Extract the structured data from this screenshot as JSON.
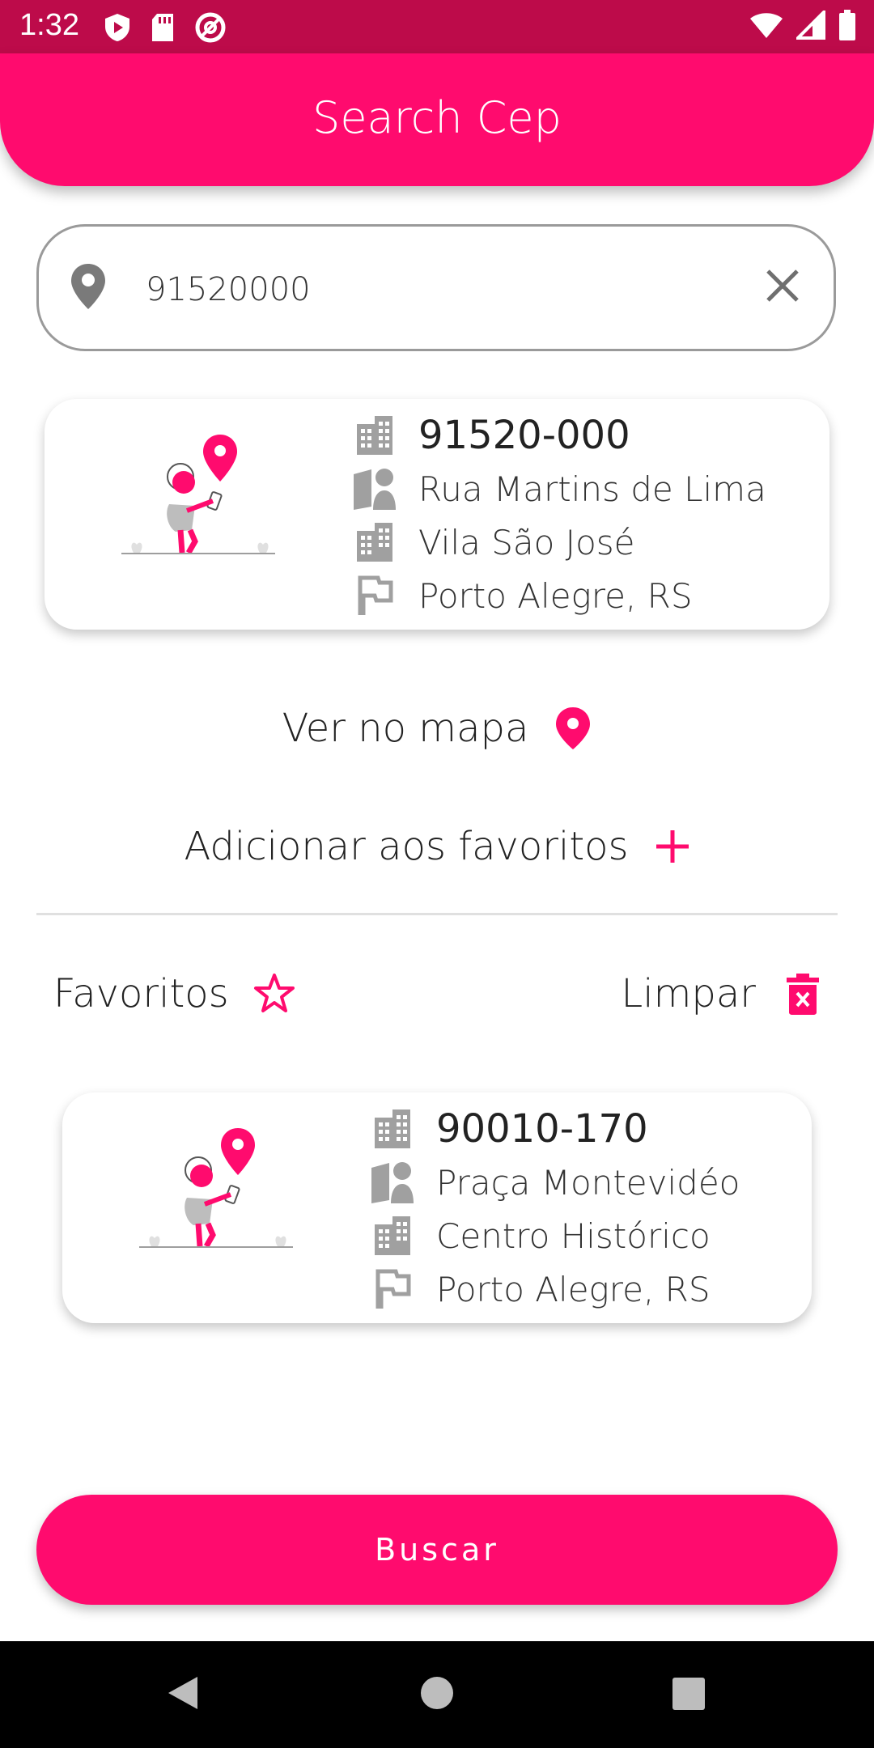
{
  "status_bar": {
    "time": "1:32"
  },
  "app_bar": {
    "title": "Search Cep"
  },
  "search": {
    "value": "91520000",
    "placeholder": ""
  },
  "result_card": {
    "cep": "91520-000",
    "street": "Rua Martins de Lima",
    "neighborhood": "Vila São José",
    "city_state": "Porto Alegre, RS"
  },
  "actions": {
    "view_map": "Ver no mapa",
    "add_favorite": "Adicionar aos favoritos"
  },
  "favorites": {
    "label": "Favoritos",
    "clear_label": "Limpar",
    "items": [
      {
        "cep": "90010-170",
        "street": "Praça Montevidéo",
        "neighborhood": "Centro Histórico",
        "city_state": "Porto Alegre, RS"
      }
    ]
  },
  "buscar_button": {
    "label": "Buscar"
  },
  "colors": {
    "accent": "#ff0b6e",
    "status_bar": "#bd0b4a",
    "icon_gray": "#9e9e9e"
  }
}
